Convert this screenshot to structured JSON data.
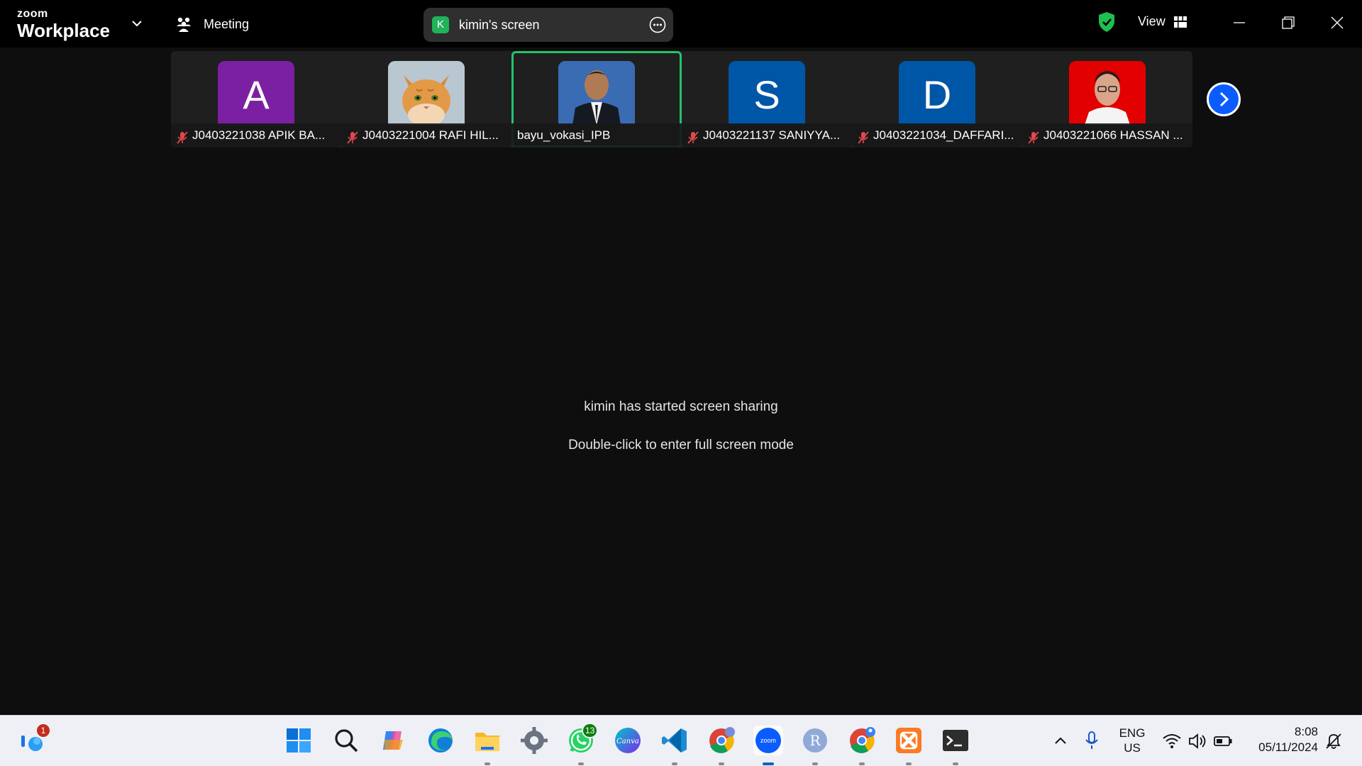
{
  "titlebar": {
    "brand_small": "zoom",
    "brand_big": "Workplace",
    "meeting_label": "Meeting",
    "share": {
      "avatar_letter": "K",
      "label": "kimin's screen"
    },
    "view_label": "View"
  },
  "participants": [
    {
      "name": "J0403221038 APIK BA...",
      "avatar": "A",
      "style": "purple",
      "muted": true,
      "active": false
    },
    {
      "name": "J0403221004 RAFI HIL...",
      "avatar": "",
      "style": "cat",
      "muted": true,
      "active": false
    },
    {
      "name": "bayu_vokasi_IPB",
      "avatar": "",
      "style": "photo",
      "muted": false,
      "active": true
    },
    {
      "name": "J0403221137 SANIYYA...",
      "avatar": "S",
      "style": "blue",
      "muted": true,
      "active": false
    },
    {
      "name": "J0403221034_DAFFARI...",
      "avatar": "D",
      "style": "blue",
      "muted": true,
      "active": false
    },
    {
      "name": "J0403221066 HASSAN ...",
      "avatar": "",
      "style": "red",
      "muted": true,
      "active": false
    }
  ],
  "main": {
    "message1": "kimin has started screen sharing",
    "message2": "Double-click to enter full screen mode"
  },
  "taskbar": {
    "widgets_badge": "1",
    "whatsapp_badge": "13",
    "canva_label": "Canva",
    "zoom_label": "zoom",
    "r_label": "R",
    "language_line1": "ENG",
    "language_line2": "US",
    "time": "8:08",
    "date": "05/11/2024",
    "icons": [
      "widgets-icon",
      "start-icon",
      "search-icon",
      "copilot-icon",
      "edge-icon",
      "file-explorer-icon",
      "settings-icon",
      "whatsapp-icon",
      "canva-icon",
      "vscode-icon",
      "chrome-icon",
      "zoom-icon",
      "r-icon",
      "chrome-profile-icon",
      "xampp-icon",
      "terminal-icon"
    ]
  },
  "colors": {
    "active_border": "#25c26b",
    "accent_blue": "#0b5cff",
    "avatar_purple": "#7b20a2",
    "avatar_blue": "#0056a6",
    "share_avatar_green": "#22b25a"
  }
}
